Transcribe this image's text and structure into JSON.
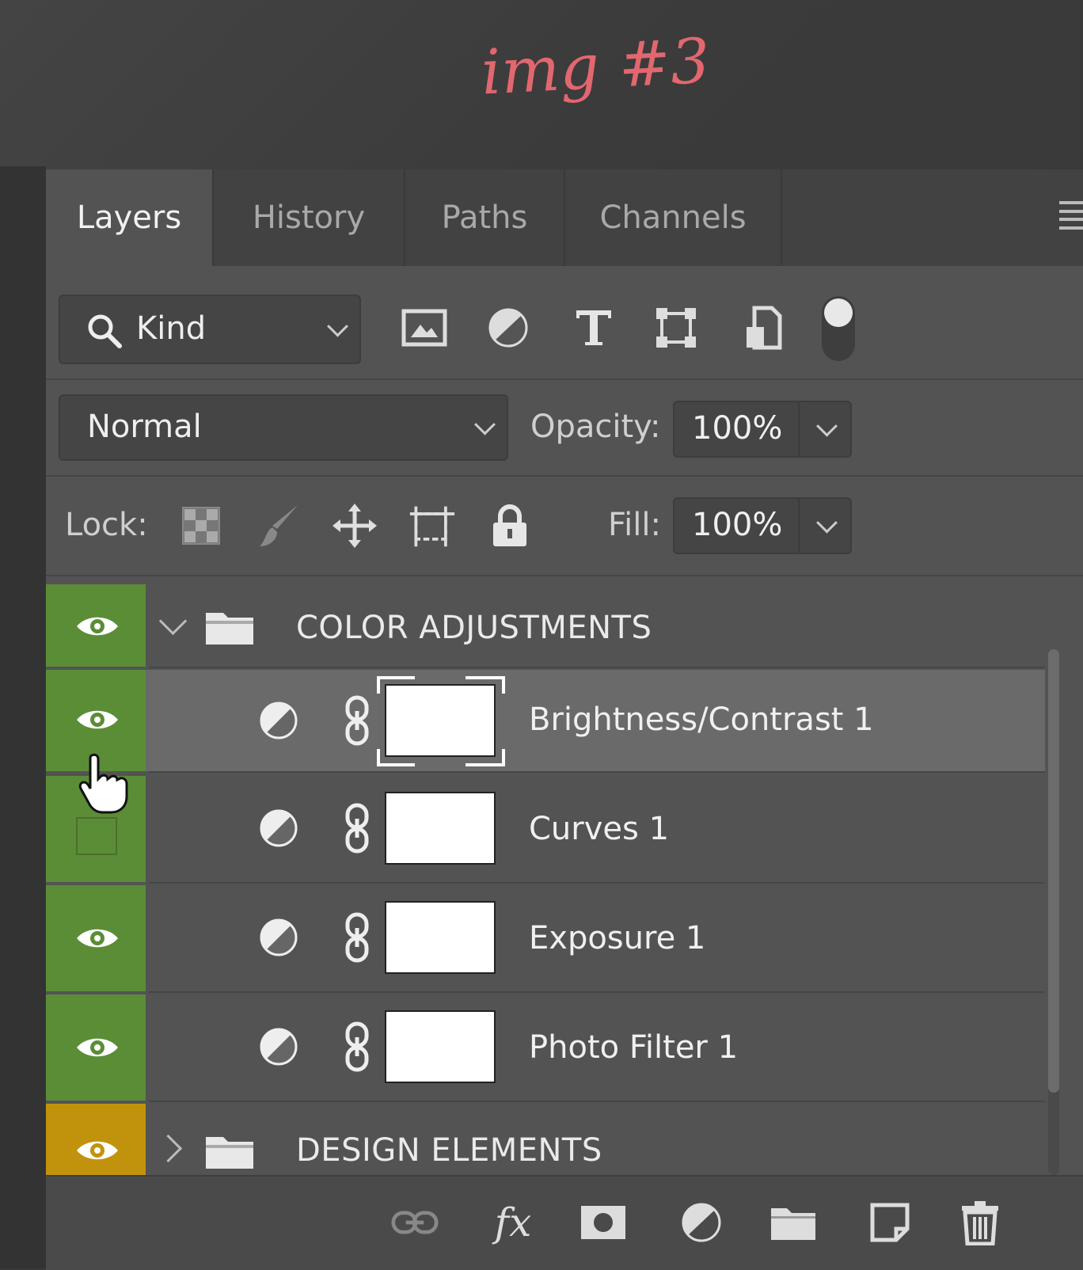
{
  "annotation": "img #3",
  "tabs": [
    "Layers",
    "History",
    "Paths",
    "Channels"
  ],
  "filter": {
    "kind_label": "Kind",
    "icons": [
      "pixel-layer-filter-icon",
      "adjustment-layer-filter-icon",
      "type-layer-filter-icon",
      "shape-layer-filter-icon",
      "smart-object-filter-icon",
      "filter-toggle-icon"
    ]
  },
  "blend": {
    "mode": "Normal",
    "opacity_label": "Opacity:",
    "opacity_value": "100%"
  },
  "lock": {
    "label": "Lock:",
    "icons": [
      "lock-transparent-pixels-icon",
      "lock-image-pixels-icon",
      "lock-position-icon",
      "lock-artboard-icon",
      "lock-all-icon"
    ],
    "fill_label": "Fill:",
    "fill_value": "100%"
  },
  "layers": {
    "group1": {
      "name": "COLOR ADJUSTMENTS",
      "expanded": true,
      "visible": true,
      "color": "#5b8d37"
    },
    "items": [
      {
        "name": "Brightness/Contrast 1",
        "visible": true,
        "selected": true
      },
      {
        "name": "Curves 1",
        "visible": false,
        "selected": false
      },
      {
        "name": "Exposure 1",
        "visible": true,
        "selected": false
      },
      {
        "name": "Photo Filter 1",
        "visible": true,
        "selected": false
      }
    ],
    "group2": {
      "name": "DESIGN ELEMENTS",
      "expanded": false,
      "visible": true,
      "color": "#c1930c"
    }
  },
  "bottom_icons": [
    "link-layers-icon",
    "fx-icon",
    "add-mask-icon",
    "new-adjustment-icon",
    "new-group-icon",
    "new-layer-icon",
    "delete-icon"
  ],
  "bottom_fx_label": "fx"
}
